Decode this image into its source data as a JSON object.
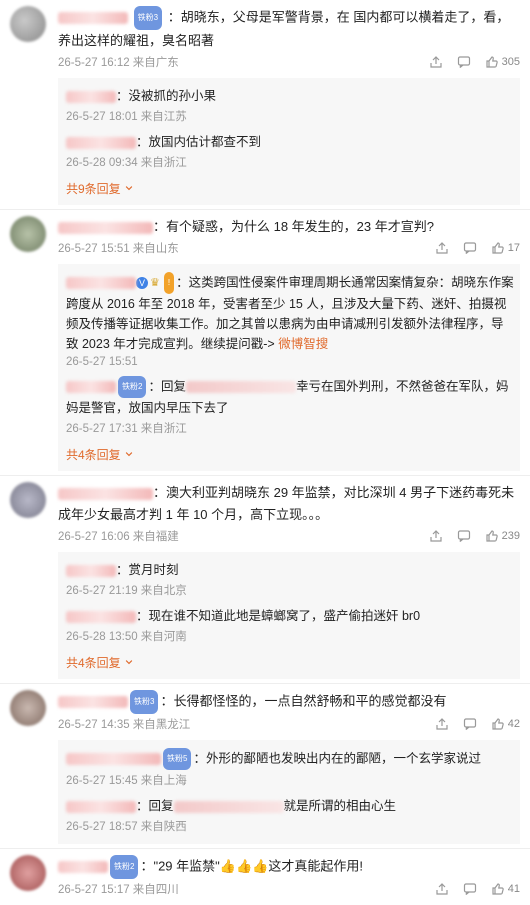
{
  "comments": [
    {
      "text": "：胡晓东，父母是军警背景，在 国内都可以横着走了，看，养出这样的耀祖，臭名昭著",
      "time": "26-5-27 16:12 来自广东",
      "likes": "305",
      "replies": [
        {
          "text": "：没被抓的孙小果",
          "time": "26-5-27 18:01 来自江苏"
        },
        {
          "text": "：放国内估计都查不到",
          "time": "26-5-28 09:34 来自浙江"
        }
      ],
      "more": "共9条回复"
    },
    {
      "text": "：有个疑惑，为什么 18 年发生的，23 年才宣判?",
      "time": "26-5-27 15:51 来自山东",
      "likes": "17",
      "replies": [
        {
          "text": "：这类跨国性侵案件审理周期长通常因案情复杂：胡晓东作案跨度从 2016 年至 2018 年，受害者至少 15 人，且涉及大量下药、迷奸、拍摄视频及传播等证据收集工作。加之其曾以患病为由申请减刑引发额外法律程序，导致 2023 年才完成宣判。继续提问戳->",
          "extra_link": "微博智搜",
          "time": "26-5-27 15:51"
        },
        {
          "text": "：回复",
          "text_tail": "幸亏在国外判刑，不然爸爸在军队，妈妈是警官，放国内早压下去了",
          "time": "26-5-27 17:31 来自浙江"
        }
      ],
      "more": "共4条回复"
    },
    {
      "text": "：澳大利亚判胡晓东 29 年监禁，对比深圳 4 男子下迷药毒死未成年少女最高才判 1 年 10 个月，高下立现。。。",
      "time": "26-5-27 16:06 来自福建",
      "likes": "239",
      "replies": [
        {
          "text": "：赏月时刻",
          "time": "26-5-27 21:19 来自北京"
        },
        {
          "text": "：现在谁不知道此地是蟑螂窝了，盛产偷拍迷奸 br0",
          "time": "26-5-28 13:50 来自河南"
        }
      ],
      "more": "共4条回复"
    },
    {
      "text": "：长得都怪怪的，一点自然舒畅和平的感觉都没有",
      "time": "26-5-27 14:35 来自黑龙江",
      "likes": "42",
      "replies": [
        {
          "text": "：外形的鄙陋也发映出内在的鄙陋，一个玄学家说过",
          "time": "26-5-27 15:45 来自上海"
        },
        {
          "text": "：回复",
          "text_tail": "就是所谓的相由心生",
          "time": "26-5-27 18:57 来自陕西"
        }
      ]
    },
    {
      "text": "：\"29 年监禁\"👍👍👍这才真能起作用!",
      "time": "26-5-27 15:17 来自四川",
      "likes": "41"
    }
  ],
  "badges": {
    "fan": "铁粉3",
    "fan2": "铁粉2",
    "fan5": "铁粉5"
  },
  "icons": {
    "share": "share-icon",
    "comment": "comment-icon",
    "like": "thumbs-up-icon",
    "more": "chevron-down-icon"
  }
}
